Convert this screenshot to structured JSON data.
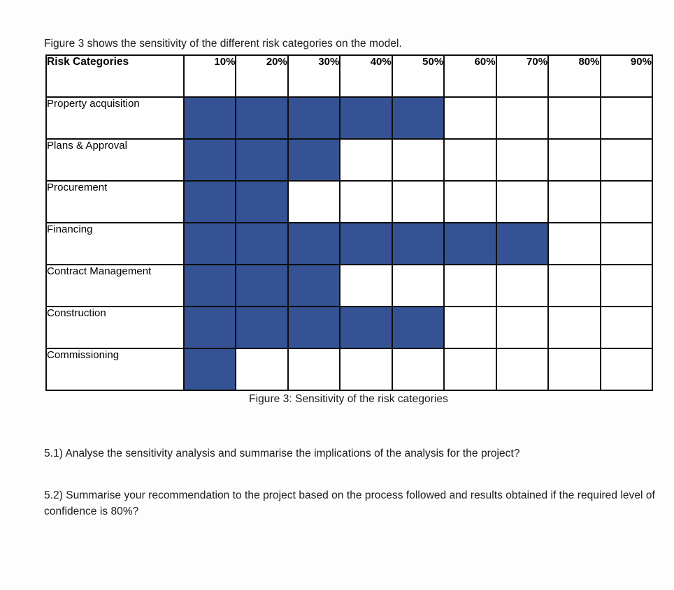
{
  "document": {
    "intro_text": "Figure 3 shows the sensitivity of the different risk categories on the model.",
    "caption": "Figure 3: Sensitivity of the risk categories",
    "questions": [
      "5.1) Analyse the sensitivity analysis and summarise the implications of the analysis for the project?",
      "5.2) Summarise your recommendation to the project based on the process followed and results obtained if the required level of confidence is 80%?"
    ]
  },
  "colors": {
    "bar_fill": "#355394",
    "grid_line": "#0d0d0d",
    "page_background": "#fdfdfd",
    "cell_background": "#ffffff",
    "text": "#1a1a1a"
  },
  "chart_data": {
    "type": "bar",
    "title": "Figure 3: Sensitivity of the risk categories",
    "xlabel": "",
    "ylabel": "Risk Categories",
    "orientation": "horizontal",
    "grid": true,
    "legend": "none",
    "row_header_label": "Risk Categories",
    "categories": [
      "Property acquisition",
      "Plans & Approval",
      "Procurement",
      "Financing",
      "Contract Management",
      "Construction",
      "Commissioning"
    ],
    "column_headers": [
      "10%",
      "20%",
      "30%",
      "40%",
      "50%",
      "60%",
      "70%",
      "80%",
      "90%"
    ],
    "column_values": [
      10,
      20,
      30,
      40,
      50,
      60,
      70,
      80,
      90
    ],
    "xlim": [
      0,
      90
    ],
    "values": [
      50,
      30,
      20,
      70,
      30,
      50,
      10
    ],
    "filled_counts": [
      5,
      3,
      2,
      7,
      3,
      5,
      1
    ],
    "matrix": [
      [
        1,
        1,
        1,
        1,
        1,
        0,
        0,
        0,
        0
      ],
      [
        1,
        1,
        1,
        0,
        0,
        0,
        0,
        0,
        0
      ],
      [
        1,
        1,
        0,
        0,
        0,
        0,
        0,
        0,
        0
      ],
      [
        1,
        1,
        1,
        1,
        1,
        1,
        1,
        0,
        0
      ],
      [
        1,
        1,
        1,
        0,
        0,
        0,
        0,
        0,
        0
      ],
      [
        1,
        1,
        1,
        1,
        1,
        0,
        0,
        0,
        0
      ],
      [
        1,
        0,
        0,
        0,
        0,
        0,
        0,
        0,
        0
      ]
    ]
  }
}
